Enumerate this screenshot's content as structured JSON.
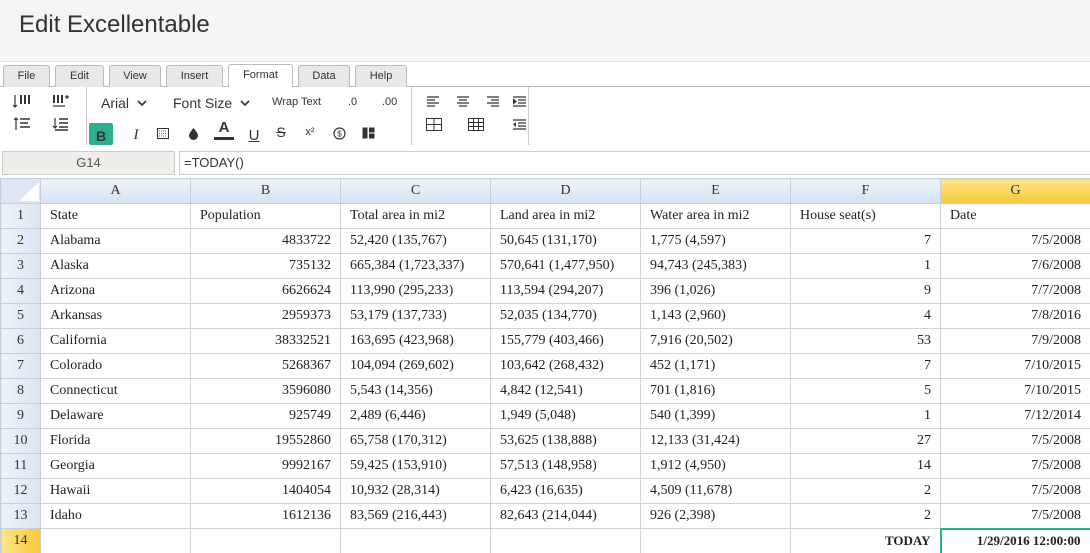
{
  "app": {
    "title": "Edit Excellentable"
  },
  "menu_tabs": [
    {
      "label": "File"
    },
    {
      "label": "Edit"
    },
    {
      "label": "View"
    },
    {
      "label": "Insert"
    },
    {
      "label": "Format",
      "active": true
    },
    {
      "label": "Data"
    },
    {
      "label": "Help"
    }
  ],
  "toolbar": {
    "font_family": "Arial",
    "font_size_label": "Font Size",
    "wrap_text_label": "Wrap Text",
    "decrease_decimal_label": ".0",
    "increase_decimal_label": ".00",
    "bold_label": "B",
    "italic_label": "I",
    "font_color_label": "A",
    "underline_label": "U",
    "strikethrough_label": "S",
    "superscript_label": "x²",
    "bold_active_color": "#2baf8f"
  },
  "formula_bar": {
    "cell_ref": "G14",
    "formula": "=TODAY()"
  },
  "grid": {
    "selected_cell": "G14",
    "selection_color": "#2baf8f",
    "header_highlight_color": "#f6c93a",
    "columns": [
      "A",
      "B",
      "C",
      "D",
      "E",
      "F",
      "G"
    ],
    "rows": [
      {
        "n": "1",
        "cells": [
          "State",
          "Population",
          "Total area in mi2",
          "Land area in mi2",
          "Water area in mi2",
          "House seat(s)",
          "Date"
        ]
      },
      {
        "n": "2",
        "cells": [
          "Alabama",
          "4833722",
          "52,420 (135,767)",
          "50,645 (131,170)",
          "1,775 (4,597)",
          "7",
          "7/5/2008"
        ]
      },
      {
        "n": "3",
        "cells": [
          "Alaska",
          "735132",
          "665,384 (1,723,337)",
          "570,641 (1,477,950)",
          "94,743 (245,383)",
          "1",
          "7/6/2008"
        ]
      },
      {
        "n": "4",
        "cells": [
          "Arizona",
          "6626624",
          "113,990 (295,233)",
          "113,594 (294,207)",
          "396 (1,026)",
          "9",
          "7/7/2008"
        ]
      },
      {
        "n": "5",
        "cells": [
          "Arkansas",
          "2959373",
          "53,179 (137,733)",
          "52,035 (134,770)",
          "1,143 (2,960)",
          "4",
          "7/8/2016"
        ]
      },
      {
        "n": "6",
        "cells": [
          "California",
          "38332521",
          "163,695 (423,968)",
          "155,779 (403,466)",
          "7,916 (20,502)",
          "53",
          "7/9/2008"
        ]
      },
      {
        "n": "7",
        "cells": [
          "Colorado",
          "5268367",
          "104,094 (269,602)",
          "103,642 (268,432)",
          "452 (1,171)",
          "7",
          "7/10/2015"
        ]
      },
      {
        "n": "8",
        "cells": [
          "Connecticut",
          "3596080",
          "5,543 (14,356)",
          "4,842 (12,541)",
          "701 (1,816)",
          "5",
          "7/10/2015"
        ]
      },
      {
        "n": "9",
        "cells": [
          "Delaware",
          "925749",
          "2,489 (6,446)",
          "1,949 (5,048)",
          "540 (1,399)",
          "1",
          "7/12/2014"
        ]
      },
      {
        "n": "10",
        "cells": [
          "Florida",
          "19552860",
          "65,758 (170,312)",
          "53,625 (138,888)",
          "12,133 (31,424)",
          "27",
          "7/5/2008"
        ]
      },
      {
        "n": "11",
        "cells": [
          "Georgia",
          "9992167",
          "59,425 (153,910)",
          "57,513 (148,958)",
          "1,912 (4,950)",
          "14",
          "7/5/2008"
        ]
      },
      {
        "n": "12",
        "cells": [
          "Hawaii",
          "1404054",
          "10,932 (28,314)",
          "6,423 (16,635)",
          "4,509 (11,678)",
          "2",
          "7/5/2008"
        ]
      },
      {
        "n": "13",
        "cells": [
          "Idaho",
          "1612136",
          "83,569 (216,443)",
          "82,643 (214,044)",
          "926 (2,398)",
          "2",
          "7/5/2008"
        ]
      },
      {
        "n": "14",
        "cells": [
          "",
          "",
          "",
          "",
          "",
          "TODAY",
          "1/29/2016 12:00:00"
        ]
      }
    ]
  }
}
